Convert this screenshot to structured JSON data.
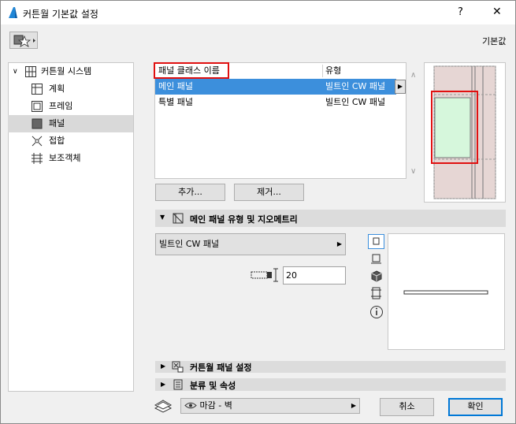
{
  "window": {
    "title": "커튼월 기본값 설정",
    "help_label": "?",
    "close_label": "✕"
  },
  "header": {
    "defaults_label": "기본값"
  },
  "tree": {
    "root_label": "커튼월 시스템",
    "items": [
      {
        "label": "계획"
      },
      {
        "label": "프레임"
      },
      {
        "label": "패널"
      },
      {
        "label": "접합"
      },
      {
        "label": "보조객체"
      }
    ]
  },
  "panel_table": {
    "col_name": "패널 클래스 이름",
    "col_type": "유형",
    "rows": [
      {
        "name": "메인 패널",
        "type": "빌트인 CW 패널"
      },
      {
        "name": "특별 패널",
        "type": "빌트인 CW 패널"
      }
    ]
  },
  "actions": {
    "add_label": "추가...",
    "remove_label": "제거..."
  },
  "sections": {
    "main_panel_title": "메인 패널 유형 및 지오메트리",
    "cw_panel_settings_title": "커튼월 패널 설정",
    "classification_title": "분류 및 속성"
  },
  "geometry": {
    "type_value": "빌트인 CW 패널",
    "thickness_value": "20"
  },
  "footer": {
    "layer_value": "마감 - 벽",
    "cancel_label": "취소",
    "ok_label": "확인"
  },
  "colors": {
    "selection": "#3c8fdc",
    "accent_red": "#e01010",
    "panel_green": "#d6f7dc"
  }
}
